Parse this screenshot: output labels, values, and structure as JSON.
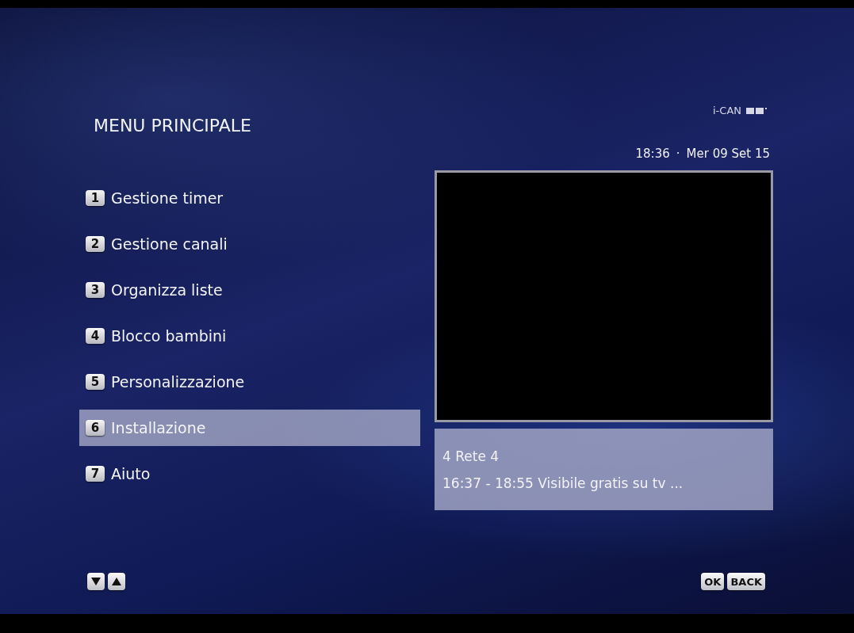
{
  "brand": {
    "name": "i-CAN"
  },
  "title": "MENU PRINCIPALE",
  "clock": {
    "time": "18:36",
    "separator": "·",
    "date": "Mer 09 Set 15"
  },
  "menu": [
    {
      "key": "1",
      "label": "Gestione timer",
      "selected": false
    },
    {
      "key": "2",
      "label": "Gestione canali",
      "selected": false
    },
    {
      "key": "3",
      "label": "Organizza liste",
      "selected": false
    },
    {
      "key": "4",
      "label": "Blocco bambini",
      "selected": false
    },
    {
      "key": "5",
      "label": "Personalizzazione",
      "selected": false
    },
    {
      "key": "6",
      "label": "Installazione",
      "selected": true
    },
    {
      "key": "7",
      "label": "Aiuto",
      "selected": false
    }
  ],
  "channel_info": {
    "channel": "4 Rete 4",
    "program": "16:37 - 18:55 Visibile gratis su tv ..."
  },
  "footer": {
    "buttons": [
      "OK",
      "BACK"
    ]
  }
}
